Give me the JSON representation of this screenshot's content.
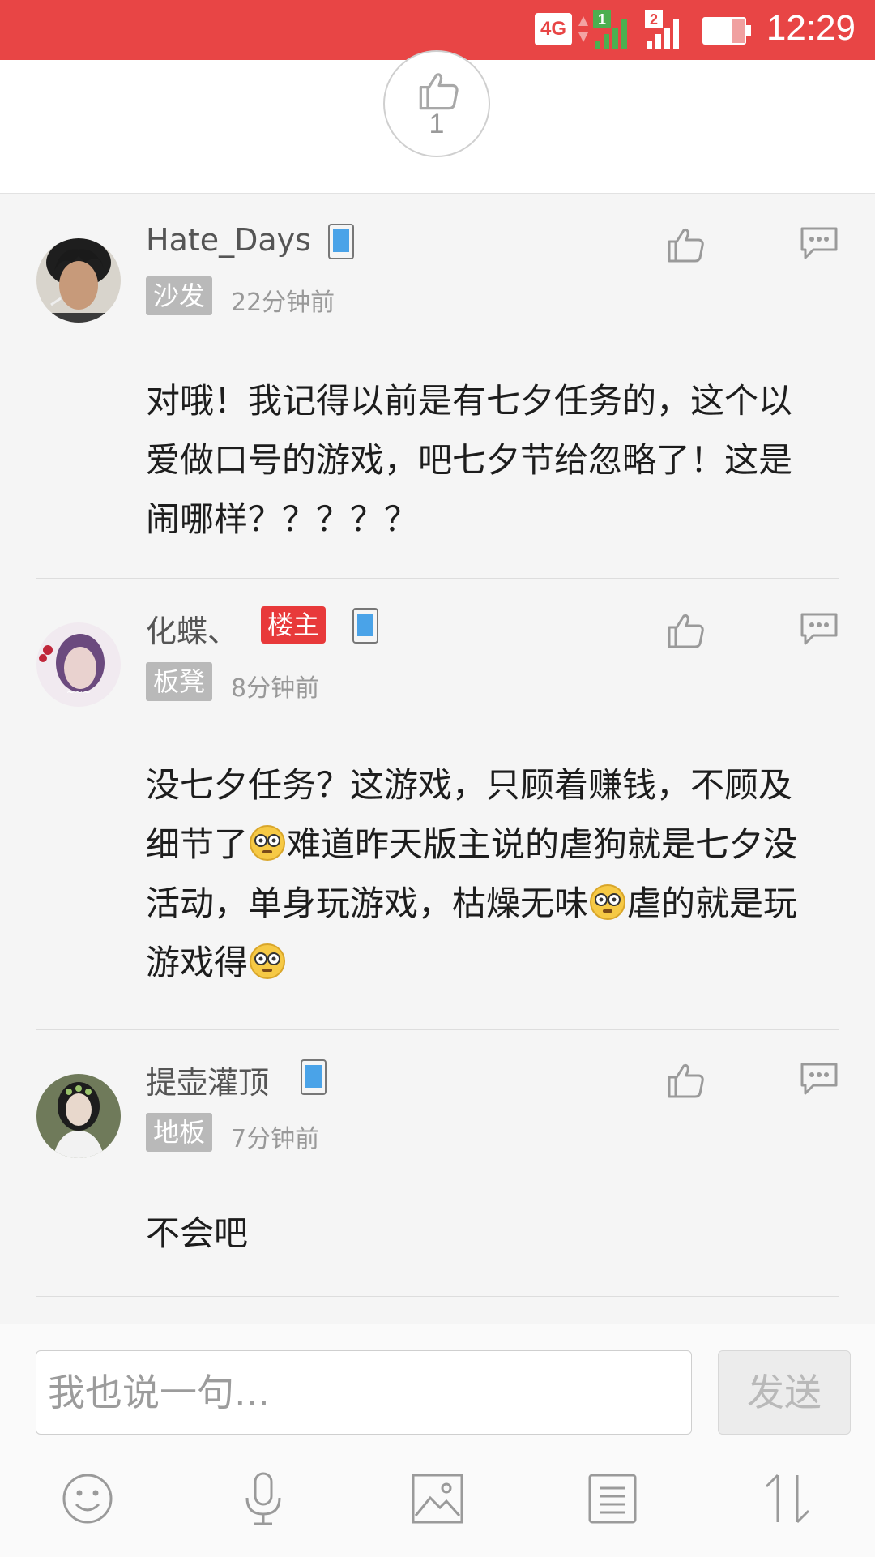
{
  "status_bar": {
    "network": "4G",
    "sim1": "1",
    "sim2": "2",
    "time": "12:29",
    "background": "#e84545"
  },
  "post_like": {
    "count": "1"
  },
  "comments": [
    {
      "username": "Hate_Days",
      "floor": "沙发",
      "time": "22分钟前",
      "text": "对哦！我记得以前是有七夕任务的，这个以爱做口号的游戏，吧七夕节给忽略了！这是闹哪样？？？？？",
      "is_owner": false
    },
    {
      "username": "化蝶、",
      "owner_badge": "楼主",
      "floor": "板凳",
      "time": "8分钟前",
      "text_parts": [
        "没七夕任务？这游戏，只顾着赚钱，不顾及细节了",
        "难道昨天版主说的虐狗就是七夕没活动，单身玩游戏，枯燥无味",
        "虐的就是玩游戏得"
      ],
      "emoji": "dazed-face-emoji",
      "is_owner": true
    },
    {
      "username": "提壶灌顶",
      "floor": "地板",
      "time": "7分钟前",
      "text": "不会吧",
      "is_owner": false
    }
  ],
  "reply_bar": {
    "placeholder": "我也说一句...",
    "send_label": "发送"
  },
  "toolbar_icons": [
    "emoji-icon",
    "microphone-icon",
    "image-icon",
    "list-icon",
    "sort-arrows-icon"
  ],
  "colors": {
    "accent": "#e84545",
    "owner_badge": "#e8393a",
    "floor_badge": "#b9b9b9",
    "phone_icon": "#4aa3e8"
  }
}
